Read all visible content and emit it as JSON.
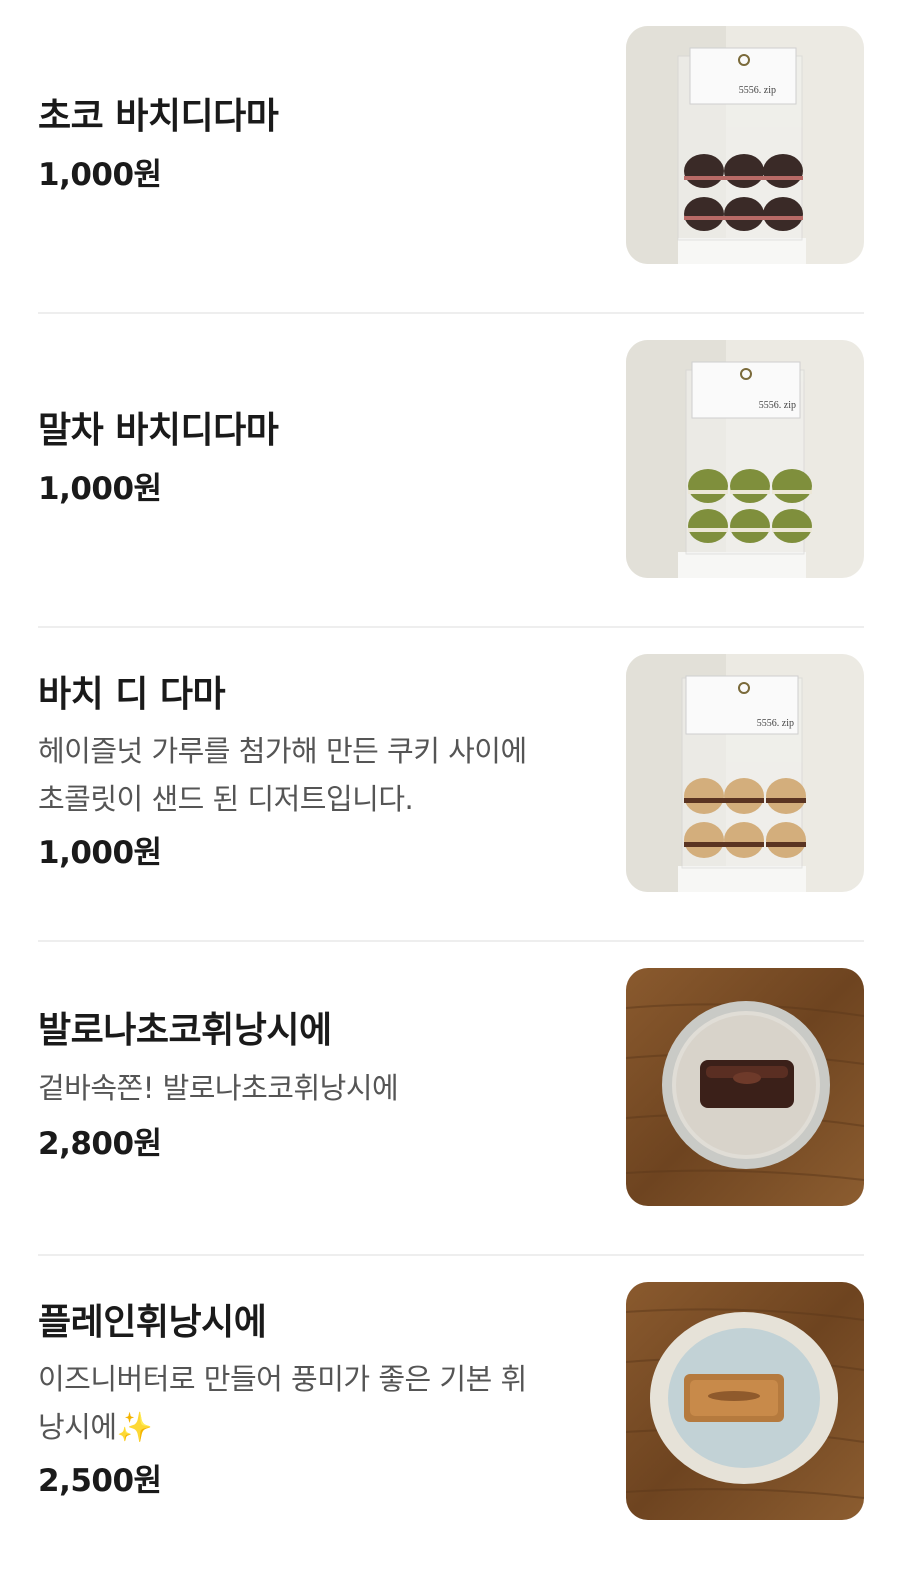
{
  "menu": {
    "items": [
      {
        "name": "초코 바치디다마",
        "desc1": "",
        "desc2": "",
        "price": "1,000원",
        "photo_icon": "bag-icon",
        "bag_label": "5556. zip",
        "cookie_color": "#3a2a27",
        "filling_color": "#b86a66"
      },
      {
        "name": "말차 바치디다마",
        "desc1": "",
        "desc2": "",
        "price": "1,000원",
        "photo_icon": "bag-icon",
        "bag_label": "5556. zip",
        "cookie_color": "#7f8f3c",
        "filling_color": "#ece7d6"
      },
      {
        "name": "바치 디 다마",
        "desc1": "헤이즐넛 가루를 첨가해 만든 쿠키 사이에",
        "desc2": "초콜릿이 샌드 된 디저트입니다.",
        "price": "1,000원",
        "photo_icon": "bag-icon",
        "bag_label": "5556. zip",
        "cookie_color": "#d3ae7c",
        "filling_color": "#5a3422"
      },
      {
        "name": "발로나초코휘낭시에",
        "desc1": "겉바속쫀! 발로나초코휘낭시에",
        "desc2": "",
        "price": "2,800원",
        "photo_icon": "plate-icon"
      },
      {
        "name": "플레인휘낭시에",
        "desc1": "이즈니버터로 만들어 풍미가 좋은 기본 휘",
        "desc2": "낭시에✨",
        "price": "2,500원",
        "photo_icon": "plate-icon"
      }
    ]
  }
}
